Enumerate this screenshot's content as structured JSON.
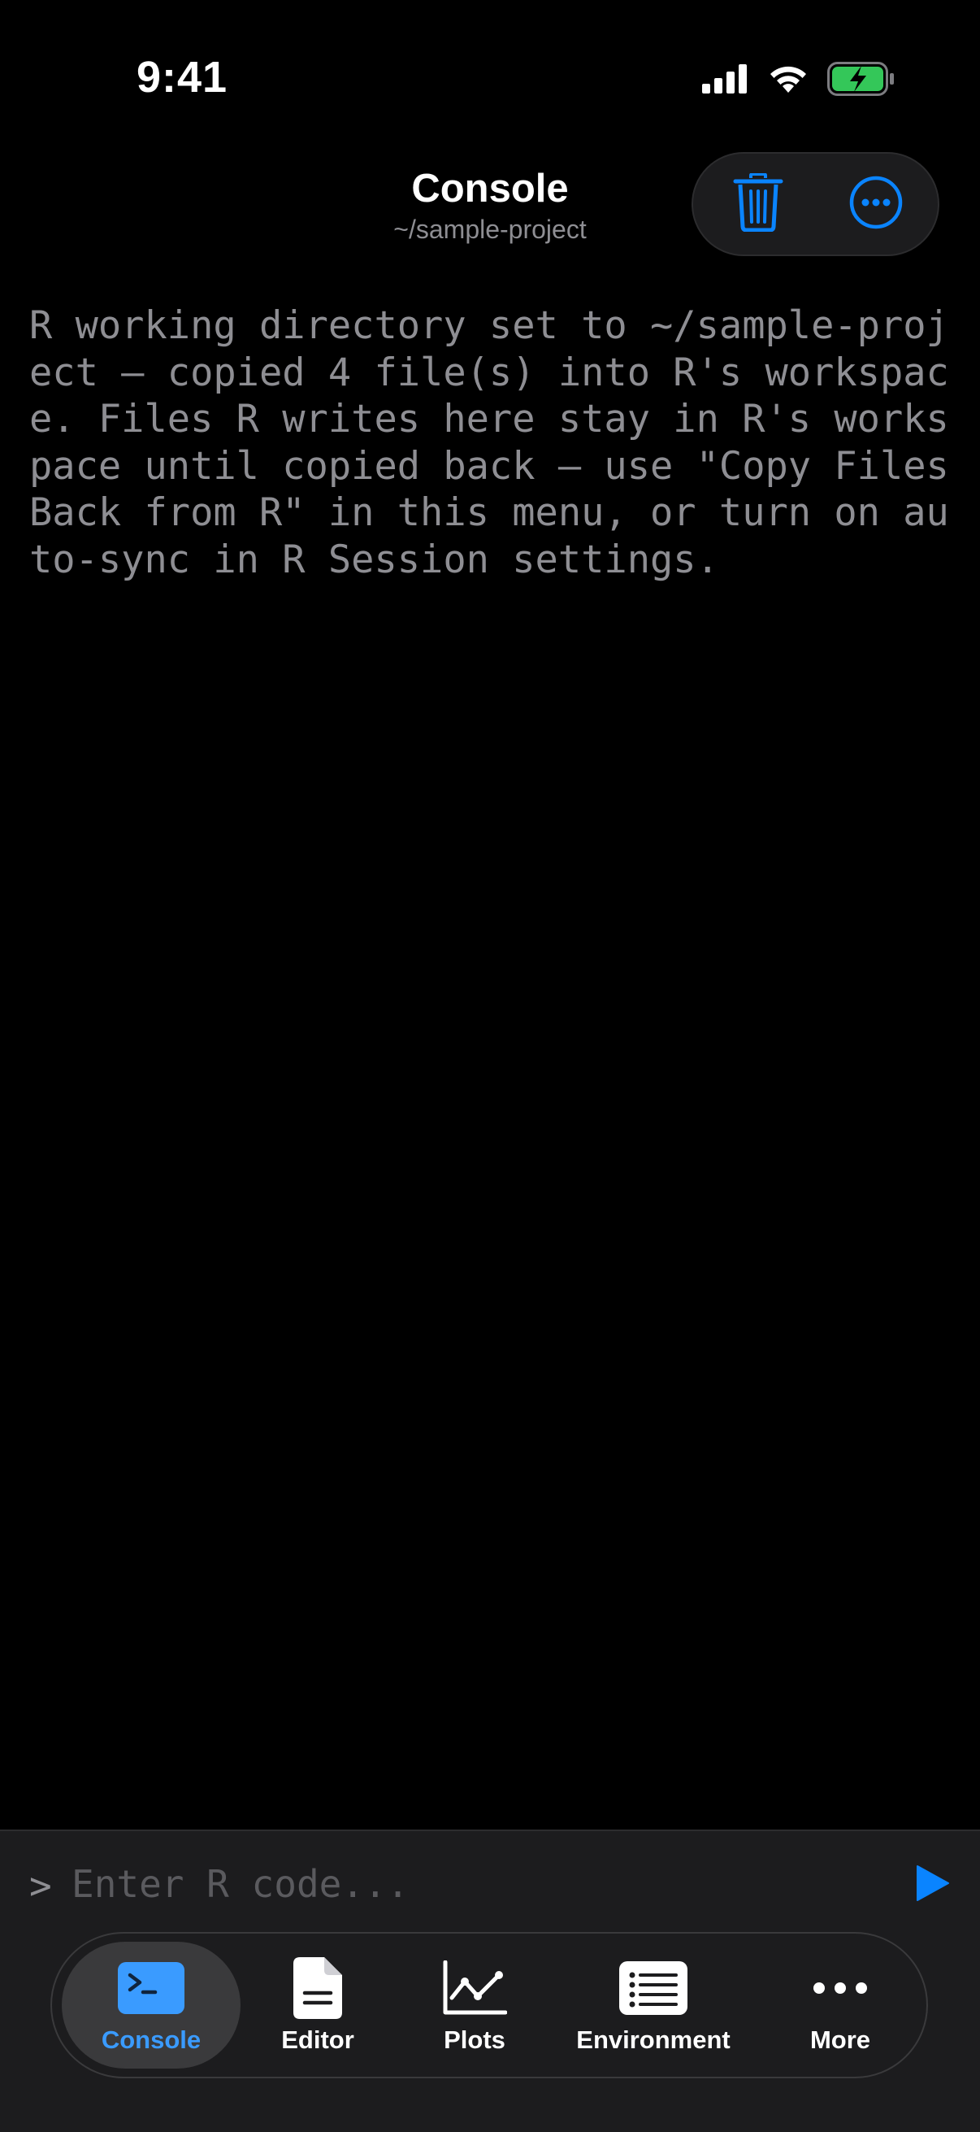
{
  "status_bar": {
    "time": "9:41"
  },
  "header": {
    "title": "Console",
    "subtitle": "~/sample-project",
    "actions": [
      {
        "icon": "trash-icon"
      },
      {
        "icon": "ellipsis-circle-icon"
      }
    ]
  },
  "console": {
    "output": "R working directory set to ~/sample-project — copied 4 file(s) into R's workspace. Files R writes here stay in R's workspace until copied back — use \"Copy Files Back from R\" in this menu, or turn on auto-sync in R Session settings."
  },
  "input": {
    "prompt": ">",
    "placeholder": "Enter R code...",
    "value": ""
  },
  "tabs": [
    {
      "label": "Console",
      "icon": "terminal-icon",
      "active": true
    },
    {
      "label": "Editor",
      "icon": "document-icon",
      "active": false
    },
    {
      "label": "Plots",
      "icon": "line-chart-icon",
      "active": false
    },
    {
      "label": "Environment",
      "icon": "list-icon",
      "active": false
    },
    {
      "label": "More",
      "icon": "ellipsis-icon",
      "active": false
    }
  ],
  "colors": {
    "accent": "#0a84ff",
    "active_tab_label": "#3a9bff",
    "console_text": "#8e8e93",
    "battery_green": "#34c759"
  }
}
